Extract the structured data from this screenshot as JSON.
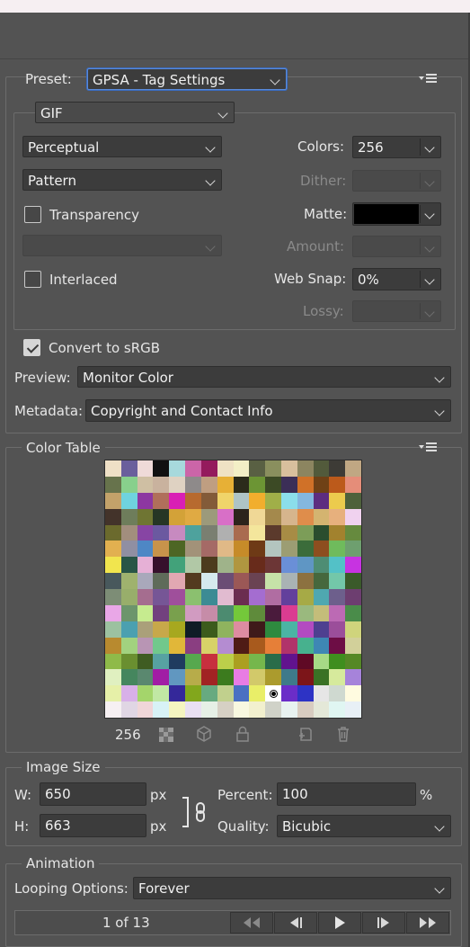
{
  "preset": {
    "label": "Preset:",
    "value": "GPSA - Tag Settings"
  },
  "format": "GIF",
  "reduction": "Perceptual",
  "dither_algorithm": "Pattern",
  "transparency": {
    "label": "Transparency",
    "checked": false
  },
  "transparency_dither": "",
  "interlaced": {
    "label": "Interlaced",
    "checked": false
  },
  "colors": {
    "label": "Colors:",
    "value": "256"
  },
  "dither": {
    "label": "Dither:",
    "value": ""
  },
  "matte": {
    "label": "Matte:",
    "color": "#000000"
  },
  "amount": {
    "label": "Amount:",
    "value": ""
  },
  "web_snap": {
    "label": "Web Snap:",
    "value": "0%"
  },
  "lossy": {
    "label": "Lossy:",
    "value": ""
  },
  "convert_srgb": {
    "label": "Convert to sRGB",
    "checked": true
  },
  "preview": {
    "label": "Preview:",
    "value": "Monitor Color"
  },
  "metadata": {
    "label": "Metadata:",
    "value": "Copyright and Contact Info"
  },
  "color_table": {
    "title": "Color Table",
    "count": "256",
    "colors": [
      "#efe0c6",
      "#6a5f9c",
      "#efdad8",
      "#111111",
      "#a7d9dc",
      "#cb65a8",
      "#941a5d",
      "#efe2c4",
      "#f3efc6",
      "#596043",
      "#8a8f5e",
      "#d8bf9d",
      "#8c8560",
      "#525a3b",
      "#3d3b36",
      "#c0a783",
      "#67734c",
      "#88d08c",
      "#cfbfa3",
      "#c9b29e",
      "#dfd2c2",
      "#8e8a8a",
      "#bf9e81",
      "#e7b036",
      "#2b2b1b",
      "#6c9534",
      "#3c4a25",
      "#3b2e57",
      "#d07128",
      "#6f4116",
      "#bc5a1b",
      "#e58d79",
      "#c3a26a",
      "#6fd3de",
      "#8d37a1",
      "#b06f5b",
      "#d91fb5",
      "#b76a2f",
      "#835b39",
      "#f0d46a",
      "#aec4c6",
      "#f1ae2d",
      "#a0af48",
      "#8bdeeb",
      "#84b7df",
      "#5d2d80",
      "#eccb4d",
      "#4e613b",
      "#43332a",
      "#6e7d5b",
      "#6f7533",
      "#263625",
      "#d3a238",
      "#e0aa43",
      "#9c9a7b",
      "#d86fc7",
      "#2c241c",
      "#f0d896",
      "#a4894c",
      "#d6b58d",
      "#df8d4b",
      "#d4b470",
      "#e7b07d",
      "#f0d2ef",
      "#6b6a2d",
      "#a28e7d",
      "#8745a4",
      "#6b59a0",
      "#c78ac0",
      "#4ea29d",
      "#7a7f71",
      "#b0b0b0",
      "#a96b4f",
      "#f4e69c",
      "#5b3a2c",
      "#a78c45",
      "#7c9d58",
      "#2a4d2e",
      "#a2822e",
      "#668a3e",
      "#e2b050",
      "#908fa2",
      "#4e87c5",
      "#c7934b",
      "#4d6624",
      "#a29279",
      "#a56a66",
      "#e0b987",
      "#c68b29",
      "#6e3a16",
      "#b3c5bf",
      "#9c9d73",
      "#3b6c3a",
      "#8d4e1f",
      "#6fbb5c",
      "#6e9f6f",
      "#f1e54e",
      "#295546",
      "#e6b0d6",
      "#36102c",
      "#42a27a",
      "#b1c8a6",
      "#4c3b1d",
      "#9fb38a",
      "#b09640",
      "#682b1b",
      "#6c3636",
      "#6a8fd7",
      "#5f96c4",
      "#4e8d74",
      "#53c1c7",
      "#c733e1",
      "#48585c",
      "#9fb26e",
      "#a9a8bb",
      "#5f6b5a",
      "#e2a8b2",
      "#533a1f",
      "#d5e9ed",
      "#6b4d75",
      "#9b5856",
      "#6a4353",
      "#c6e2a8",
      "#a9b3b4",
      "#8c7140",
      "#46683d",
      "#73c7a9",
      "#3a5a2a",
      "#7d8d76",
      "#98ae6b",
      "#a56d8f",
      "#765696",
      "#9f4f9b",
      "#8bc06f",
      "#3c8b94",
      "#e1bbd0",
      "#6b2d50",
      "#a46dd0",
      "#b06da2",
      "#63409c",
      "#a6aa46",
      "#4fa8b0",
      "#6d5f8c",
      "#6d3e70",
      "#e9a7e7",
      "#6c956c",
      "#c6eb8f",
      "#72417e",
      "#79a04d",
      "#d19bc1",
      "#c68ca8",
      "#4c8b70",
      "#74c83a",
      "#5f8b3b",
      "#4a1b3c",
      "#db3c91",
      "#9ab97e",
      "#c4bd7a",
      "#bc6ab4",
      "#4a8c4a",
      "#9cc1a0",
      "#4ba0b0",
      "#aaa07a",
      "#c7a84a",
      "#a7a81f",
      "#0f1c26",
      "#3c5b1c",
      "#8fb35e",
      "#dd8ca1",
      "#3f1a1a",
      "#2e8a3f",
      "#4bb4a4",
      "#b34bc1",
      "#4e4090",
      "#9b4e9a",
      "#cfd47c",
      "#b88a2f",
      "#a2d27f",
      "#b895b4",
      "#71c88c",
      "#e1b739",
      "#8a3e81",
      "#d7d268",
      "#b48cd1",
      "#4f1b15",
      "#a85a1d",
      "#e67f38",
      "#b1336a",
      "#47b18e",
      "#3e87b4",
      "#6d0d45",
      "#d2d09a",
      "#8fba49",
      "#6a8f30",
      "#3f5c22",
      "#57a2a2",
      "#1f3b5f",
      "#56a84e",
      "#c7303e",
      "#bccf4a",
      "#ab9f20",
      "#75b74c",
      "#296c49",
      "#61138e",
      "#5f0925",
      "#a7da86",
      "#3f8e1e",
      "#558826",
      "#e0f0c0",
      "#45865e",
      "#5a886f",
      "#a11da5",
      "#6197c0",
      "#b7ac4a",
      "#a12323",
      "#3c7b1e",
      "#e87ce4",
      "#d2c96a",
      "#ab9b2d",
      "#3e7a8a",
      "#7c1519",
      "#3a7225",
      "#d6ea9c",
      "#a683da",
      "#e6f0a8",
      "#d8b0e8",
      "#a4d56b",
      "#c1e8a4",
      "#34289a",
      "#82a71c",
      "#67aa80",
      "#c1d08d",
      "#4a70c2",
      "#e9ee68",
      "#ffffff",
      "#6b2dc8",
      "#2d33c5",
      "#e6e6e6",
      "#cfd9d0",
      "#fffbe0",
      "#f6f0f2",
      "#e0d6e4",
      "#f0d6d8",
      "#d8f2f6",
      "#f5f5c0",
      "#e9e0f2",
      "#e6f0e6",
      "#d6d0c4",
      "#f8f8e0",
      "#f2f0ce",
      "#d0d2c8",
      "#e8f2f0",
      "#d8ccc0",
      "#e4e8d8",
      "#e0f6f2",
      "#e8f0f6"
    ]
  },
  "image_size": {
    "title": "Image Size",
    "w_label": "W:",
    "w_value": "650",
    "w_unit": "px",
    "h_label": "H:",
    "h_value": "663",
    "h_unit": "px",
    "percent_label": "Percent:",
    "percent_value": "100",
    "percent_unit": "%",
    "quality_label": "Quality:",
    "quality_value": "Bicubic"
  },
  "animation": {
    "title": "Animation",
    "looping_label": "Looping Options:",
    "looping_value": "Forever",
    "frame_text": "1 of 13"
  }
}
